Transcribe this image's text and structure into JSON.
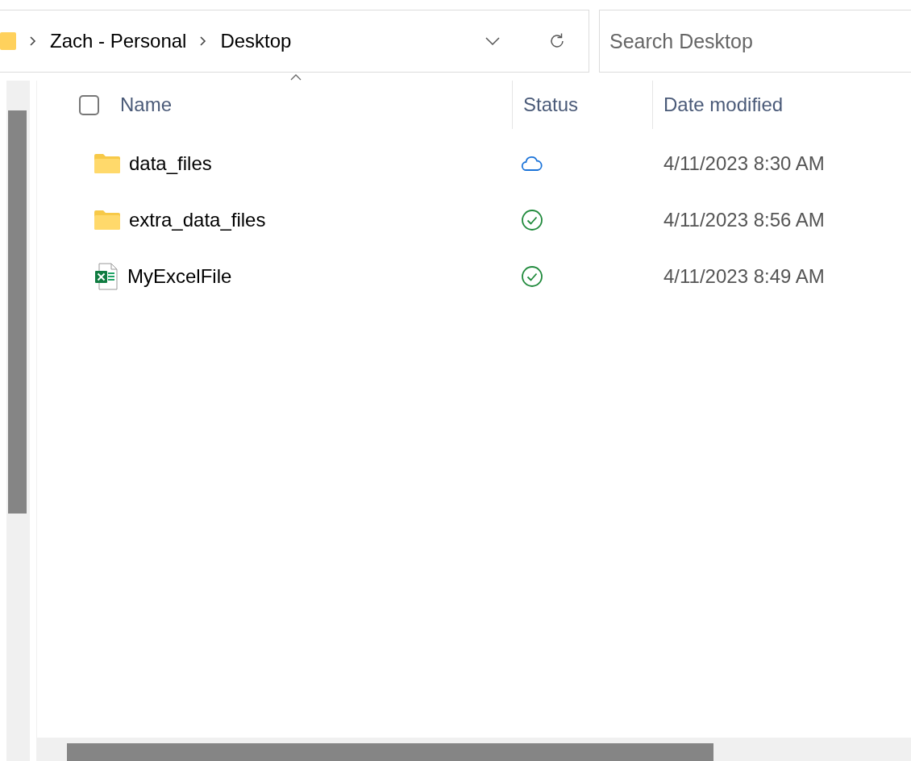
{
  "address_bar": {
    "breadcrumbs": [
      "Zach - Personal",
      "Desktop"
    ]
  },
  "search": {
    "placeholder": "Search Desktop"
  },
  "columns": [
    {
      "label": "Name",
      "sorted": true
    },
    {
      "label": "Status",
      "sorted": false
    },
    {
      "label": "Date modified",
      "sorted": false
    }
  ],
  "select_all": {
    "checked": false
  },
  "rows": [
    {
      "kind": "folder",
      "name": "data_files",
      "synced": false,
      "date_modified": "4/11/2023 8:30 AM"
    },
    {
      "kind": "folder",
      "name": "extra_data_files",
      "synced": true,
      "date_modified": "4/11/2023 8:56 AM"
    },
    {
      "kind": "excel",
      "name": "MyExcelFile",
      "synced": true,
      "date_modified": "4/11/2023 8:49 AM"
    }
  ]
}
